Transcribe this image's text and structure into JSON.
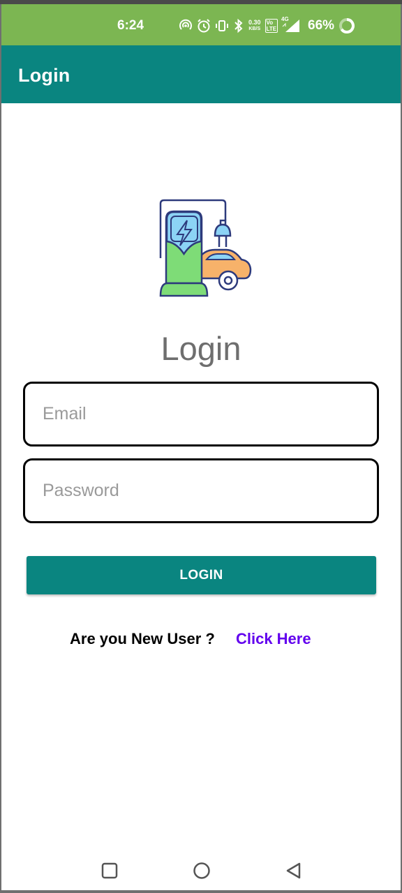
{
  "status_bar": {
    "time": "6:24",
    "net_speed_value": "0.30",
    "net_speed_unit": "KB/S",
    "volte_top": "Vo",
    "volte_bottom": "LTE",
    "network_label": "4G",
    "battery": "66%"
  },
  "app_bar": {
    "title": "Login"
  },
  "logo": {
    "icon": "ev-charging-station-car-icon"
  },
  "form": {
    "heading": "Login",
    "email": {
      "placeholder": "Email",
      "value": ""
    },
    "password": {
      "placeholder": "Password",
      "value": ""
    },
    "login_button": "LOGIN"
  },
  "signup": {
    "prompt": "Are you New User ?",
    "link": "Click Here"
  },
  "nav_bar": {
    "recents_icon": "square-icon",
    "home_icon": "circle-icon",
    "back_icon": "triangle-back-icon"
  },
  "colors": {
    "status_bar": "#7cb652",
    "primary": "#0a8580",
    "link": "#6200ee",
    "heading_text": "#6e6e6e"
  }
}
